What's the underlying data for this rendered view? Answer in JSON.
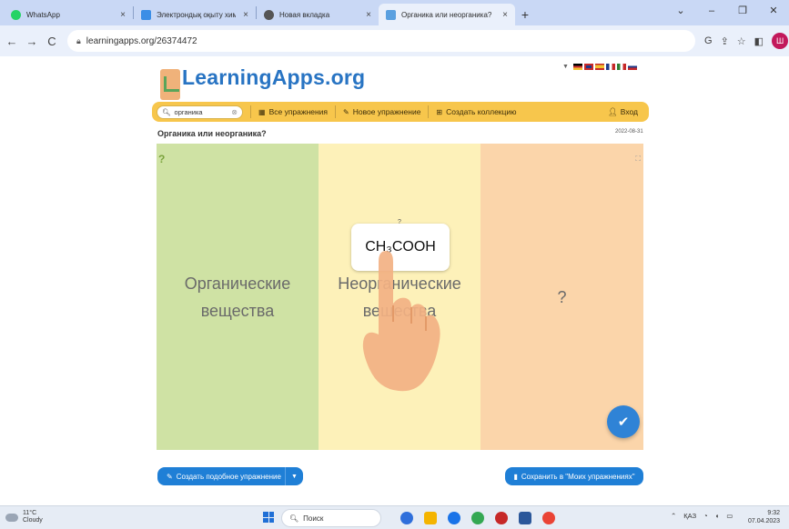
{
  "browser": {
    "tabs": [
      {
        "title": "WhatsApp",
        "favicon_color": "#25d366",
        "active": false
      },
      {
        "title": "Электрондық оқыту химиясы: Нұ",
        "favicon_color": "#3b8ee6",
        "active": false
      },
      {
        "title": "Новая вкладка",
        "favicon_color": "#555555",
        "active": false
      },
      {
        "title": "Органика или неорганика?",
        "favicon_color": "#5aa0e0",
        "active": true
      }
    ],
    "new_tab": "+",
    "close_glyph": "×",
    "window_controls": [
      "⌄",
      "–",
      "❐",
      "✕"
    ],
    "url": "learningapps.org/26374472",
    "nav": {
      "back": "←",
      "forward": "→",
      "reload": "C"
    },
    "right_icons": [
      "G",
      "⇪",
      "☆",
      "◧"
    ],
    "profile": "Ш"
  },
  "site": {
    "logo": "LearningApps.org",
    "language_arrow": "▼",
    "language_flags": [
      "#d32f2f",
      "#1e3a8a",
      "#f2c230",
      "#2e7d32",
      "#c62828"
    ]
  },
  "toolbar": {
    "search_value": "органика",
    "search_icon": "search-icon",
    "clear": "⊗",
    "all_exercises": "Все упражнения",
    "new_exercise": "Новое упражнение",
    "create_collection": "Создать коллекцию",
    "login": "Вход"
  },
  "exercise": {
    "title": "Органика или неорганика?",
    "date": "2022-08-31",
    "columns": [
      {
        "label": "Органические\nвещества",
        "color": "#cfe2a4"
      },
      {
        "label": "Неорганические\nвещества",
        "color": "#fdf1b9"
      },
      {
        "label": "?",
        "color": "#fbd5aa"
      }
    ],
    "card": "CH₃COOH",
    "card_question": "?",
    "help": "?",
    "fullscreen": "⛶",
    "check": "✔"
  },
  "buttons": {
    "create_similar": "Создать подобное упражнение",
    "save": "Сохранить в \"Моих упражнениях\""
  },
  "taskbar": {
    "weather_temp": "11°C",
    "weather_desc": "Cloudy",
    "search": "Поиск",
    "lang": "ҚАЗ",
    "time": "9:32",
    "date": "07.04.2023",
    "app_colors": [
      "#2f6fdb",
      "#f4b400",
      "#1a73e8",
      "#34a853",
      "#c62828",
      "#2b579a",
      "#ea4335"
    ]
  }
}
